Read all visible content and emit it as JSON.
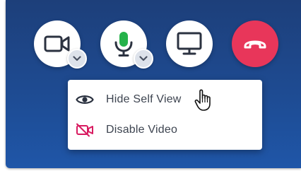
{
  "controls": [
    {
      "icon": "video-camera-icon",
      "has_caret": true
    },
    {
      "icon": "microphone-icon",
      "has_caret": true
    },
    {
      "icon": "screen-share-icon",
      "has_caret": false
    },
    {
      "icon": "end-call-icon",
      "has_caret": false
    }
  ],
  "menu": {
    "items": [
      {
        "label": "Hide Self View",
        "icon": "eye-icon"
      },
      {
        "label": "Disable Video",
        "icon": "video-off-icon"
      }
    ]
  },
  "colors": {
    "panel_top": "#1d3f7a",
    "panel_bottom": "#1f56a8",
    "end_call": "#e8365a",
    "icon": "#2b3240",
    "mic_active": "#25b24a",
    "video_off": "#d81b60"
  }
}
